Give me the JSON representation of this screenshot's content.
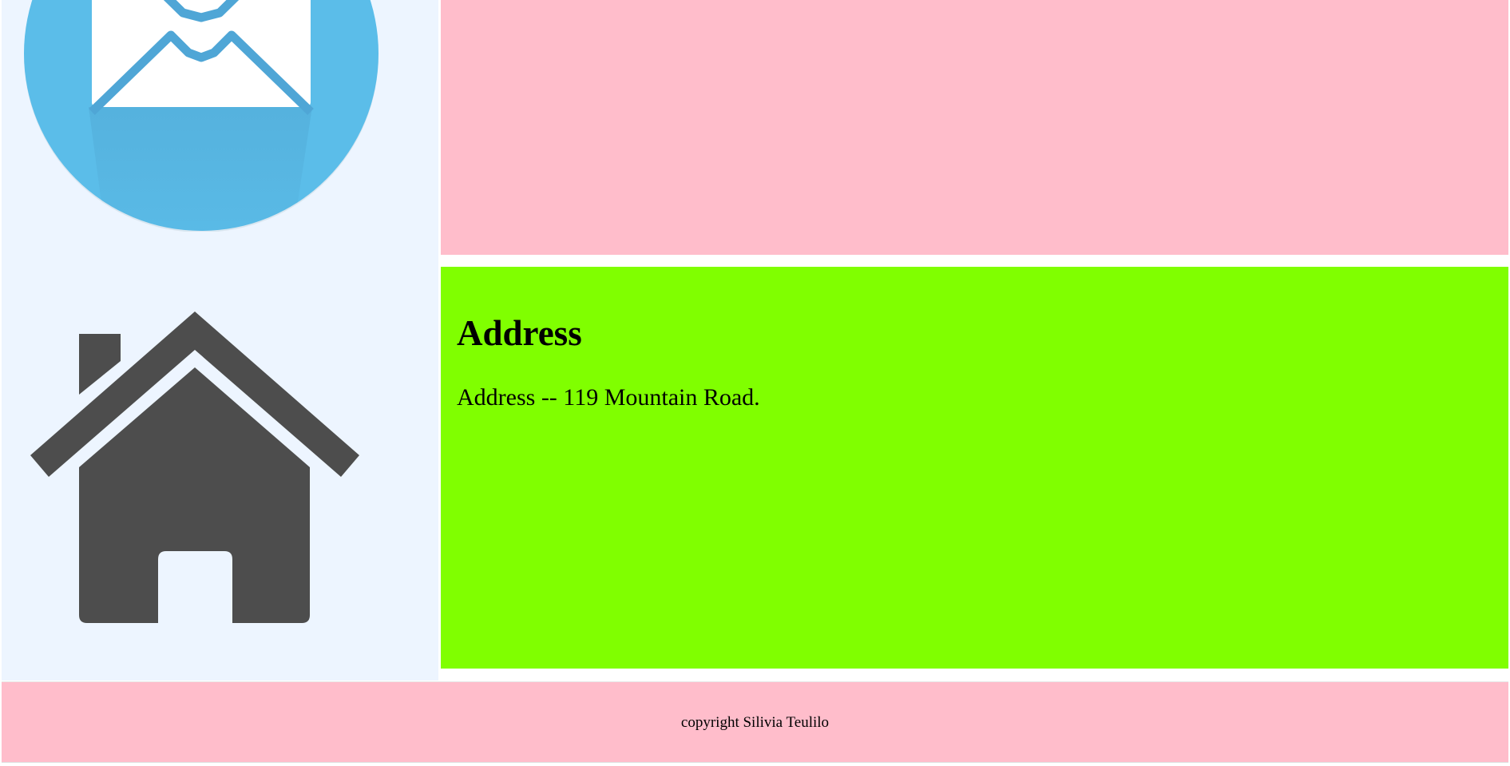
{
  "icons": {
    "mail": "mail-icon",
    "home": "home-icon"
  },
  "colors": {
    "sidebar_background": "#edf5ff",
    "top_panel": "#ffbdcb",
    "address_panel": "#80ff00",
    "footer": "#ffbdcb",
    "mail_circle": "#5bbde9",
    "house": "#4d4d4d"
  },
  "address_section": {
    "heading": "Address",
    "text": "Address -- 119 Mountain Road."
  },
  "footer": {
    "copyright": "copyright Silivia Teulilo"
  }
}
